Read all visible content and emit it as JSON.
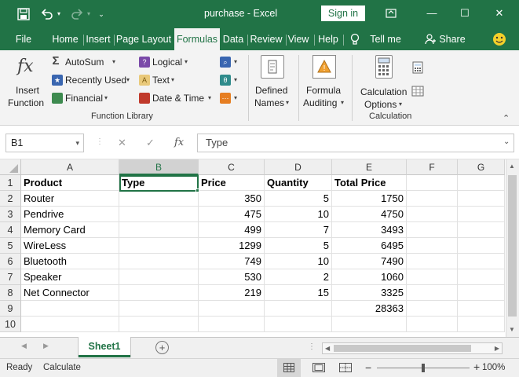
{
  "window": {
    "title": "purchase  -  Excel",
    "sign_in_label": "Sign in",
    "minimize": "—",
    "restore": "☐",
    "close": "✕"
  },
  "quick_access": {
    "save_icon": "save-icon",
    "undo_icon": "undo-icon",
    "redo_icon": "redo-icon",
    "customize_icon": "chevron-down-icon"
  },
  "tabs": [
    {
      "label": "File"
    },
    {
      "label": "Home"
    },
    {
      "label": "Insert"
    },
    {
      "label": "Page Layout"
    },
    {
      "label": "Formulas",
      "active": true
    },
    {
      "label": "Data"
    },
    {
      "label": "Review"
    },
    {
      "label": "View"
    },
    {
      "label": "Help"
    },
    {
      "label": "Tell me"
    },
    {
      "label": "Share"
    }
  ],
  "ribbon": {
    "insert_function": {
      "line1": "Insert",
      "line2": "Function",
      "icon": "fx"
    },
    "autosum": "AutoSum",
    "recently_used": "Recently Used",
    "financial": "Financial",
    "logical": "Logical",
    "text": "Text",
    "date_time": "Date & Time",
    "defined_names": {
      "line1": "Defined",
      "line2": "Names"
    },
    "formula_auditing": {
      "line1": "Formula",
      "line2": "Auditing"
    },
    "calculation_options": {
      "line1": "Calculation",
      "line2": "Options"
    },
    "group_function_library": "Function Library",
    "group_calculation": "Calculation",
    "icon_glyphs": {
      "sigma": "Σ",
      "star": "★",
      "question": "?",
      "A": "A",
      "theta": "θ"
    }
  },
  "formula_bar": {
    "name_box": "B1",
    "cancel": "✕",
    "enter": "✓",
    "fx": "fx",
    "value": "Type"
  },
  "grid": {
    "columns": [
      "A",
      "B",
      "C",
      "D",
      "E",
      "F",
      "G"
    ],
    "rows": [
      "1",
      "2",
      "3",
      "4",
      "5",
      "6",
      "7",
      "8",
      "9",
      "10"
    ],
    "cells": [
      [
        "Product",
        "Type",
        "Price",
        "Quantity",
        "Total Price",
        "",
        ""
      ],
      [
        "Router",
        "",
        "350",
        "5",
        "1750",
        "",
        ""
      ],
      [
        "Pendrive",
        "",
        "475",
        "10",
        "4750",
        "",
        ""
      ],
      [
        "Memory Card",
        "",
        "499",
        "7",
        "3493",
        "",
        ""
      ],
      [
        "WireLess",
        "",
        "1299",
        "5",
        "6495",
        "",
        ""
      ],
      [
        "Bluetooth",
        "",
        "749",
        "10",
        "7490",
        "",
        ""
      ],
      [
        "Speaker",
        "",
        "530",
        "2",
        "1060",
        "",
        ""
      ],
      [
        "Net Connector",
        "",
        "219",
        "15",
        "3325",
        "",
        ""
      ],
      [
        "",
        "",
        "",
        "",
        "28363",
        "",
        ""
      ],
      [
        "",
        "",
        "",
        "",
        "",
        "",
        ""
      ]
    ],
    "selected_cell": "B1"
  },
  "sheets": {
    "tabs": [
      "Sheet1"
    ],
    "add_icon": "plus-circle-icon"
  },
  "status": {
    "ready": "Ready",
    "calculate": "Calculate",
    "zoom": "100%",
    "zoom_minus": "−",
    "zoom_plus": "+",
    "zoom_level": 0.5
  },
  "colors": {
    "accent": "#217346",
    "ribbon_bg": "#f3f3f3",
    "grid_line": "#e1e1e1"
  }
}
